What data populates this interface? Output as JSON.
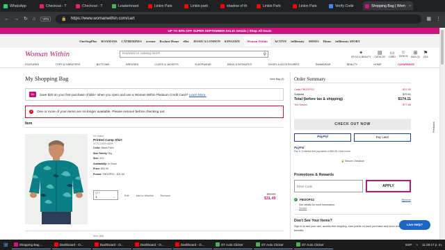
{
  "browser": {
    "tabs": [
      {
        "label": "WhatsApp",
        "color": "#25d366"
      },
      {
        "label": "Checkout - T",
        "color": "#e91e63"
      },
      {
        "label": "Checkout - T",
        "color": "#e91e63"
      },
      {
        "label": "Leaderboard",
        "color": "#4caf50"
      },
      {
        "label": "Linkin Park",
        "color": "#ff0000"
      },
      {
        "label": "Linkin park",
        "color": "#ff0000"
      },
      {
        "label": "shadow of th",
        "color": "#ff0000"
      },
      {
        "label": "Linkin Park",
        "color": "#ff0000"
      },
      {
        "label": "Linkin Park",
        "color": "#ff0000"
      },
      {
        "label": "Verify Code",
        "color": "#4285f4"
      },
      {
        "label": "Shopping Bag | Wom",
        "color": "#d1137f",
        "active": true
      }
    ],
    "url": "https://www.womanwithin.com/cart",
    "vpn_label": "VPN"
  },
  "site": {
    "promo_banner": "UP TO 80% OFF SUPER SEPTEMBER SALE! Details | Shop All Deals",
    "brands": [
      "OneStopPlus",
      "ROAMANS",
      "CATHERINES",
      "avenue",
      "Brylane Home",
      "ellos",
      "JESSICA LONDON",
      "KINGSIZE",
      "Woman Within",
      "ACTIVE",
      "fullbeauty",
      "SHOES",
      "Home",
      "fullbeauty SPORT"
    ],
    "logo": "Woman Within",
    "search_placeholder": "Keyword or catalog item#",
    "header_icons": [
      {
        "icon": "styles-icon",
        "label": "STYLE & BEAUTY"
      },
      {
        "icon": "catalog-icon",
        "label": "CATALOG"
      },
      {
        "icon": "cards-icon",
        "label": "CARD"
      },
      {
        "icon": "signin-icon",
        "label": "SIGN IN"
      },
      {
        "icon": "bag-icon",
        "label": "BAG (3)"
      },
      {
        "icon": "flag-icon",
        "label": "USA"
      }
    ],
    "nav": [
      "FEATURED",
      "TOPS & SWEATERS",
      "BOTTOMS",
      "DRESSES",
      "COATS & JACKETS",
      "SLEEPWEAR",
      "BRAS & INTIMATES",
      "SHOES & ACCESSORIES",
      "SWIMWEAR",
      "BEAUTY",
      "HOME",
      "CLEARANCE"
    ]
  },
  "main": {
    "title": "My Shopping Bag",
    "view_all": "View Bag (3)",
    "offer_icon": "5x",
    "offer_text": "Save $20 on your first purchase of $25+ when you open and use a Woman Within Platinum Credit Card!*",
    "offer_link": "Learn More.",
    "alert_text": "One or more of your items are no longer available. Please remove before checking out.",
    "item_header": "Item",
    "product": {
      "brand": "KS Island",
      "name": "Printed Camp Shirt",
      "sku": "#179-21609-6898",
      "color_label": "Color:",
      "color": "Black Palm",
      "size_family_label": "Size Family:",
      "size_family": "Big",
      "size_label": "Size:",
      "size": "4XL",
      "availability_label": "Availability:",
      "availability": "In Stock",
      "price_label": "Price:",
      "price": "$52.99",
      "promo_label": "Promo:",
      "promo": "FBOOPS2 - $21.58",
      "qty_label": "QTY",
      "qty": "1",
      "edit": "Edit",
      "add_to_wishlist": "Add to Wishlist",
      "remove": "Remove",
      "was_price": "$52.99",
      "now_price": "$31.49"
    },
    "next_item_label": "Item: $68"
  },
  "summary": {
    "title": "Order Summary",
    "rows": [
      {
        "label": "Code FBOOPS2",
        "value": "-$21.50",
        "style": "red"
      },
      {
        "label": "Subtotal",
        "value": "$79.61",
        "style": ""
      },
      {
        "label": "Total (before tax & shipping)",
        "value": "$174.11",
        "style": "total"
      },
      {
        "label": "You Saved",
        "value": "$77.66",
        "style": "red"
      }
    ],
    "checkout": "CHECK OUT NOW",
    "paypal": "PayPal",
    "paylater": "Pay Later",
    "pp_brand": "PayPal",
    "pp_text": "Pay in 4 interest-free payments of $50.28. Learn more",
    "secure": "Secure Checkout",
    "promo_title": "Promotions & Rewards",
    "promo_placeholder": "Enter Code",
    "apply": "APPLY",
    "applied_code": "FBOOPS2",
    "applied_remove": "Remove",
    "applied_details": "See details for more information.",
    "applied_details2": "Details",
    "save_title": "Don't See Your Items?",
    "save_text": "Sign in to see your cart, access free shipping, earn points on each purchase and more exclusive benefits.",
    "help": "Live Help?",
    "feedback": "Feedback"
  },
  "taskbar": {
    "items": [
      {
        "label": "Shopping Bag ...",
        "color": "#d1137f"
      },
      {
        "label": "Dashboard - O...",
        "color": "#ff0000"
      },
      {
        "label": "Dashboard - O...",
        "color": "#ff0000"
      },
      {
        "label": "Dashboard - O...",
        "color": "#ff0000"
      },
      {
        "label": "Dashboard - G...",
        "color": "#ff0000"
      },
      {
        "label": "GT Auto Clicker",
        "color": "#4caf50"
      },
      {
        "label": "GT Auto Clicker",
        "color": "#4caf50"
      },
      {
        "label": "GT Auto Clicker",
        "color": "#4caf50"
      }
    ],
    "lang": "ESP",
    "time": "11:29:17 p. m."
  },
  "colors": {
    "brand": "#d1137f",
    "alert": "#d0102a",
    "paypal": "#1f3b8c"
  }
}
